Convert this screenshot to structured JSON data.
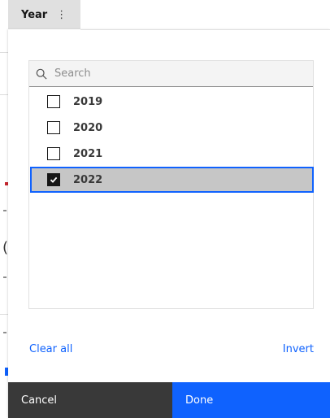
{
  "header": {
    "title": "Year"
  },
  "search": {
    "placeholder": "Search"
  },
  "items": [
    {
      "label": "2019",
      "checked": false
    },
    {
      "label": "2020",
      "checked": false
    },
    {
      "label": "2021",
      "checked": false
    },
    {
      "label": "2022",
      "checked": true
    }
  ],
  "links": {
    "clear_all": "Clear all",
    "invert": "Invert"
  },
  "buttons": {
    "cancel": "Cancel",
    "done": "Done"
  },
  "colors": {
    "accent": "#0f62fe",
    "secondary_button": "#393939",
    "selected_bg": "#c6c6c6"
  }
}
